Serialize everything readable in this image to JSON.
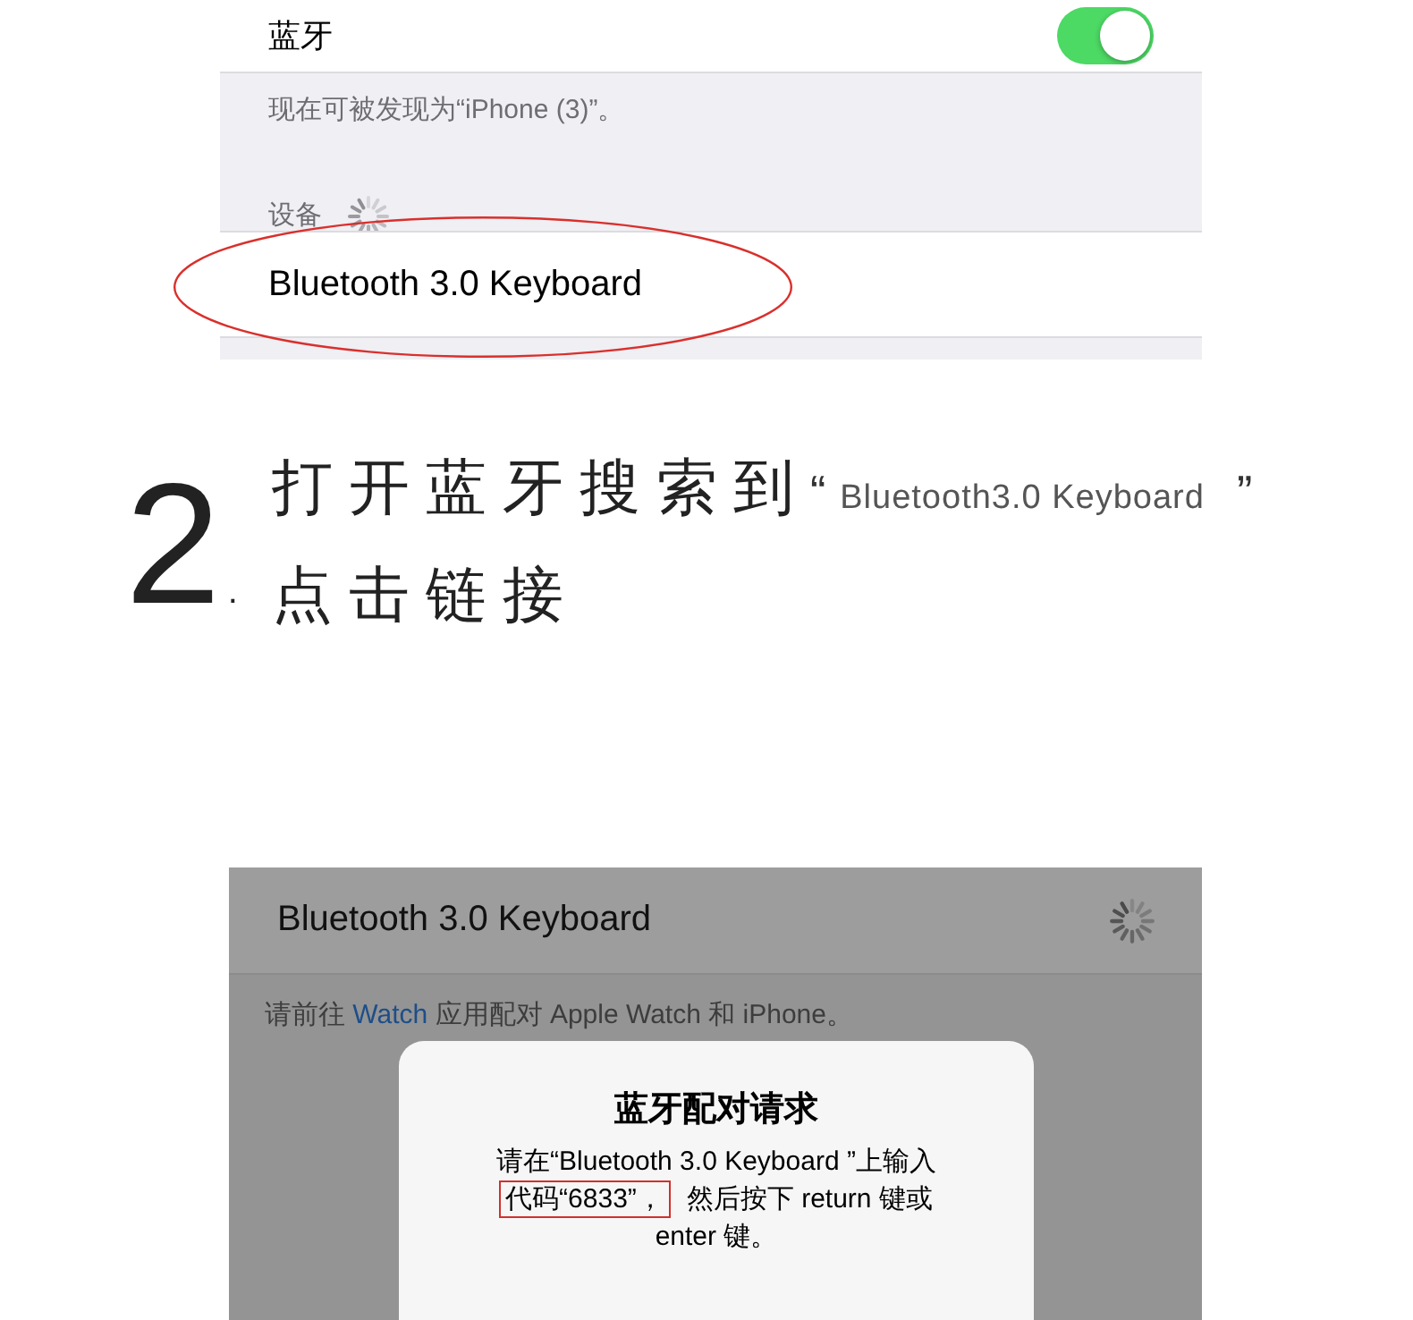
{
  "settings_screenshot": {
    "bluetooth_row": {
      "label": "蓝牙",
      "on": true
    },
    "visibility_note": "现在可被发现为“iPhone (3)”。",
    "devices_header": {
      "label": "设备",
      "searching": true
    },
    "device_row": {
      "name": "Bluetooth 3.0 Keyboard",
      "circled": true
    }
  },
  "step": {
    "number": "2",
    "number_period": ".",
    "line_1": "打开蓝牙搜索到",
    "open_quote": "“",
    "device_name": "Bluetooth3.0 Keyboard",
    "close_quote": "”",
    "line_2": "点击链接"
  },
  "pairing_screenshot": {
    "device_row": {
      "name": "Bluetooth 3.0 Keyboard",
      "connecting": true
    },
    "hint": {
      "before": "请前往 ",
      "link": "Watch",
      "after": " 应用配对 Apple Watch 和 iPhone。"
    },
    "dialog": {
      "title": "蓝牙配对请求",
      "message_lines": [
        {
          "parts": [
            {
              "text": "请在“Bluetooth 3.0 Keyboard ”上输入",
              "highlighted": false
            }
          ]
        },
        {
          "parts": [
            {
              "text": "代码“6833”，",
              "highlighted": true
            },
            {
              "text": "然后按下 return 键或",
              "highlighted": false
            }
          ]
        },
        {
          "parts": [
            {
              "text": "enter 键。",
              "highlighted": false
            }
          ]
        }
      ]
    }
  }
}
